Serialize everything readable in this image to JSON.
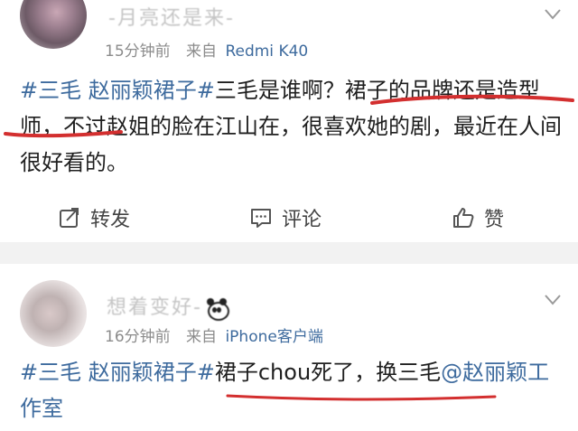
{
  "posts": [
    {
      "username": "-月亮还是来-",
      "time": "15分钟前",
      "from_label": "来自",
      "device": "Redmi K40",
      "text_segments": [
        {
          "kind": "tag",
          "text": "#三毛 赵丽颖裙子#"
        },
        {
          "kind": "plain",
          "text": "三毛是谁啊？裙子的品牌还是造型师，不过赵姐的脸在江山在，很喜欢她的剧，最近在人间很好看的。"
        }
      ],
      "actions": {
        "repost": "转发",
        "comment": "评论",
        "like": "赞"
      }
    },
    {
      "username": "想着变好-",
      "time": "16分钟前",
      "from_label": "来自",
      "device": "iPhone客户端",
      "text_tag": "#三毛 赵丽颖裙子#",
      "text_plain": "裙子chou死了，换三毛",
      "text_mention": "@赵丽颖工作室"
    }
  ],
  "colors": {
    "link": "#3e6b9e",
    "underline": "#d32f2f",
    "separator": "#f2f2f2",
    "meta": "#8c8c8c"
  },
  "icons": [
    "chevron-down-icon",
    "repost-icon",
    "comment-icon",
    "like-icon",
    "panda-emoji"
  ]
}
